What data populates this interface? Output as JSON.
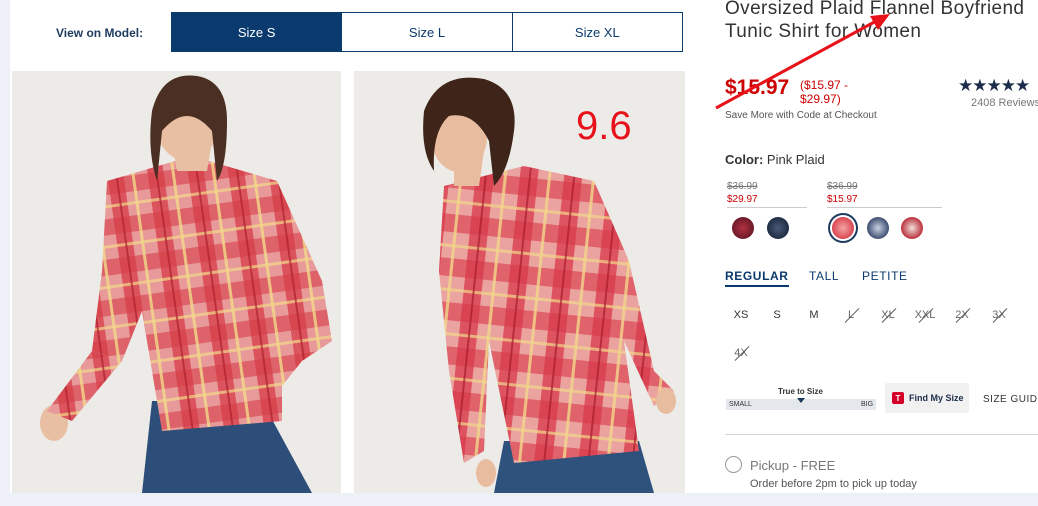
{
  "view_on_model": {
    "label": "View on Model:",
    "sizes": [
      "Size S",
      "Size L",
      "Size XL"
    ],
    "selected": "Size S"
  },
  "annotation": {
    "number": "9.6"
  },
  "product": {
    "title": "Oversized Plaid Flannel Boyfriend Tunic Shirt for Women",
    "price": "$15.97",
    "price_range": "($15.97 - $29.97)",
    "save_more": "Save More with Code at Checkout",
    "stars": "★★★★★",
    "reviews": "2408 Reviews"
  },
  "color": {
    "label": "Color:",
    "value": "Pink Plaid",
    "price_groups": [
      {
        "old": "$36.99",
        "new": "$29.97"
      },
      {
        "old": "$36.99",
        "new": "$15.97"
      }
    ],
    "swatches": [
      {
        "name": "red-navy-plaid",
        "color": "#7a1f2e"
      },
      {
        "name": "navy-red-plaid",
        "color": "#26344f"
      },
      {
        "name": "pink-plaid",
        "color": "#e86a6f",
        "selected": true
      },
      {
        "name": "blue-white-plaid",
        "color": "#4d5d7a"
      },
      {
        "name": "red-white-plaid",
        "color": "#c9363f"
      }
    ]
  },
  "fit_tabs": [
    "REGULAR",
    "TALL",
    "PETITE"
  ],
  "sizes": [
    "XS",
    "S",
    "M",
    "L",
    "XL",
    "XXL",
    "2X",
    "3X",
    "4X"
  ],
  "true_to_size": {
    "label": "True to Size",
    "small": "SMALL",
    "big": "BIG"
  },
  "find_my_size": {
    "badge": "T",
    "label": "Find My Size"
  },
  "size_guide": "SIZE GUIDE",
  "pickup": {
    "label": "Pickup - FREE",
    "sub": "Order before 2pm to pick up today"
  }
}
